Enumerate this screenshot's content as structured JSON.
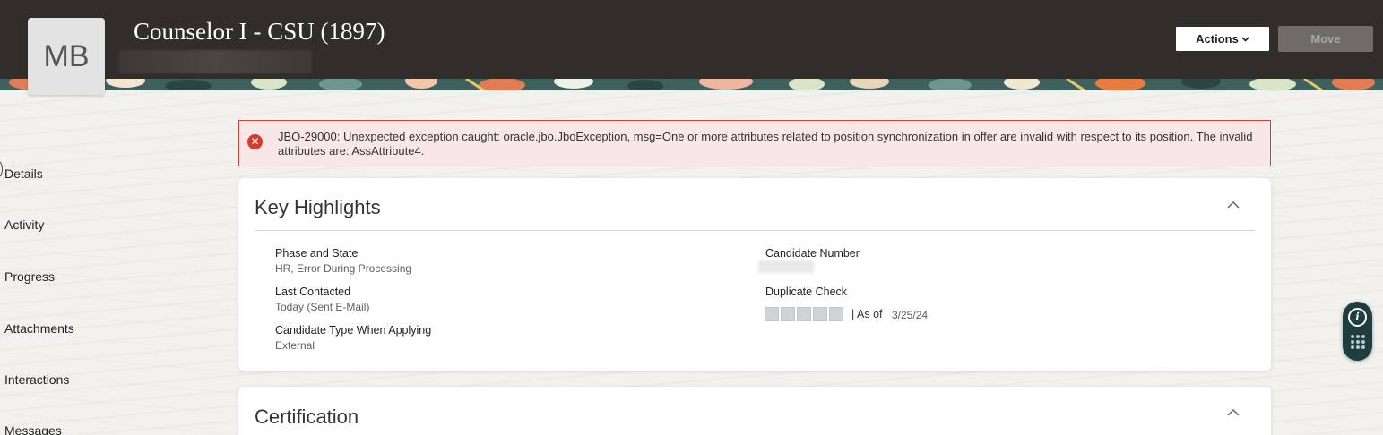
{
  "header": {
    "avatar_initials": "MB",
    "job_title": "Counselor I - CSU (1897)",
    "actions_label": "Actions",
    "move_label": "Move"
  },
  "sidebar": {
    "items": [
      {
        "label": "Details"
      },
      {
        "label": "Activity"
      },
      {
        "label": "Progress"
      },
      {
        "label": "Attachments"
      },
      {
        "label": "Interactions"
      },
      {
        "label": "Messages"
      }
    ]
  },
  "error": {
    "icon": "x-circle-icon",
    "message": "JBO-29000: Unexpected exception caught: oracle.jbo.JboException, msg=One or more attributes related to position synchronization in offer are invalid with respect to its position. The invalid attributes are: AssAttribute4."
  },
  "key_highlights": {
    "title": "Key Highlights",
    "phase_state_label": "Phase and State",
    "phase_state_value": "HR, Error During Processing",
    "last_contacted_label": "Last Contacted",
    "last_contacted_value": "Today (Sent E-Mail)",
    "candidate_type_label": "Candidate Type When Applying",
    "candidate_type_value": "External",
    "candidate_number_label": "Candidate Number",
    "duplicate_check_label": "Duplicate Check",
    "duplicate_as_of": "| As of",
    "duplicate_date": "3/25/24"
  },
  "certification": {
    "title": "Certification"
  },
  "colors": {
    "header_bg": "#312d2a",
    "error_bg": "#f9e7e7",
    "error_border": "#c74634",
    "help_widget": "#1e3d3f"
  }
}
